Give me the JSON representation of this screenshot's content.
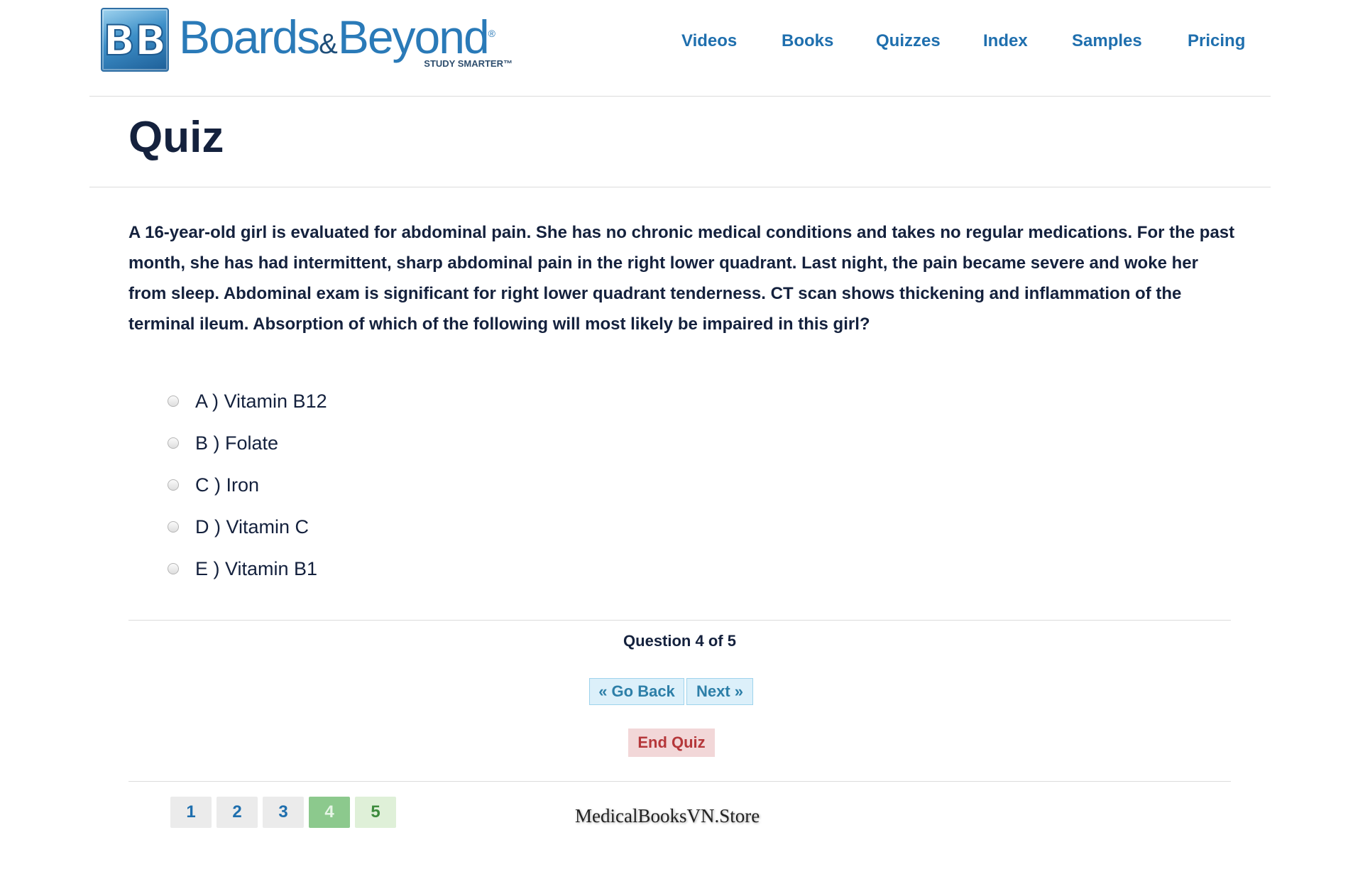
{
  "brand": {
    "logo_mark": "BB",
    "name_part1": "Boards",
    "ampersand": "&",
    "name_part2": "Beyond",
    "registered": "®",
    "tagline": "STUDY SMARTER™"
  },
  "nav": {
    "items": [
      {
        "label": "Videos"
      },
      {
        "label": "Books"
      },
      {
        "label": "Quizzes"
      },
      {
        "label": "Index"
      },
      {
        "label": "Samples"
      },
      {
        "label": "Pricing"
      }
    ]
  },
  "page": {
    "title": "Quiz"
  },
  "quiz": {
    "question": "A 16-year-old girl is evaluated for abdominal pain. She has no chronic medical conditions and takes no regular medications. For the past month, she has had intermittent, sharp abdominal pain in the right lower quadrant.  Last night, the pain became severe and woke her from sleep. Abdominal exam is significant for right lower quadrant tenderness. CT scan shows thickening and inflammation of the terminal ileum. Absorption of which of the following will most likely be impaired in this girl?",
    "options": [
      {
        "label": "A ) Vitamin B12",
        "selected": false
      },
      {
        "label": "B ) Folate",
        "selected": false
      },
      {
        "label": "C ) Iron",
        "selected": false
      },
      {
        "label": "D ) Vitamin C",
        "selected": false
      },
      {
        "label": "E ) Vitamin B1",
        "selected": false
      }
    ],
    "progress_text": "Question 4 of 5",
    "current_question": 4,
    "total_questions": 5,
    "go_back_label": "« Go Back",
    "next_label": "Next »",
    "end_label": "End Quiz",
    "pages": [
      "1",
      "2",
      "3",
      "4",
      "5"
    ]
  },
  "watermark": "MedicalBooksVN.Store",
  "colors": {
    "nav_link": "#1f6fae",
    "heading": "#14213d",
    "button_bg": "#dcf0fa",
    "button_text": "#2d7fa8",
    "end_bg": "#f2d7d8",
    "end_text": "#b5373a",
    "page_current": "#8cc98d",
    "page_next": "#dff0d8"
  }
}
